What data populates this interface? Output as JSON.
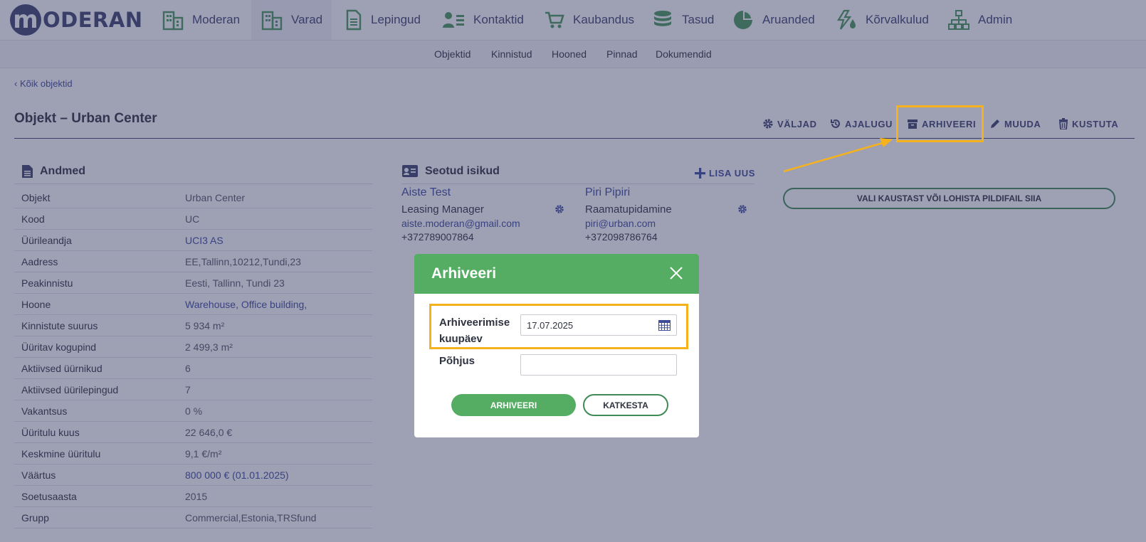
{
  "brand": {
    "logo_letter": "m",
    "logo_text": "ODERAN"
  },
  "nav": [
    {
      "label": "Moderan",
      "icon": "building-icon"
    },
    {
      "label": "Varad",
      "icon": "building-icon",
      "active": true
    },
    {
      "label": "Lepingud",
      "icon": "document-icon"
    },
    {
      "label": "Kontaktid",
      "icon": "contacts-icon"
    },
    {
      "label": "Kaubandus",
      "icon": "cart-icon"
    },
    {
      "label": "Tasud",
      "icon": "coins-icon"
    },
    {
      "label": "Aruanded",
      "icon": "pie-chart-icon"
    },
    {
      "label": "Kõrvalkulud",
      "icon": "utilities-icon"
    },
    {
      "label": "Admin",
      "icon": "sitemap-icon"
    }
  ],
  "subnav": [
    "Objektid",
    "Kinnistud",
    "Hooned",
    "Pinnad",
    "Dokumendid"
  ],
  "back_link": "‹ Kõik objektid",
  "page_title": "Objekt – Urban Center",
  "actions": {
    "fields": "VÄLJAD",
    "history": "AJALUGU",
    "archive": "ARHIVEERI",
    "edit": "MUUDA",
    "delete": "KUSTUTA"
  },
  "details": {
    "title": "Andmed",
    "rows": [
      {
        "label": "Objekt",
        "value": "Urban Center"
      },
      {
        "label": "Kood",
        "value": "UC"
      },
      {
        "label": "Üürileandja",
        "value": "UCI3 AS",
        "link": true
      },
      {
        "label": "Aadress",
        "value": "EE,Tallinn,10212,Tundi,23"
      },
      {
        "label": "Peakinnistu",
        "value": "Eesti, Tallinn, Tundi 23"
      },
      {
        "label": "Hoone",
        "value": "Warehouse, Office building,",
        "link": true
      },
      {
        "label": "Kinnistute suurus",
        "value": "5 934 m²"
      },
      {
        "label": "Üüritav kogupind",
        "value": "2 499,3 m²"
      },
      {
        "label": "Aktiivsed üürnikud",
        "value": "6"
      },
      {
        "label": "Aktiivsed üürilepingud",
        "value": "7"
      },
      {
        "label": "Vakantsus",
        "value": "0 %"
      },
      {
        "label": "Üüritulu kuus",
        "value": "22 646,0 €"
      },
      {
        "label": "Keskmine üüritulu",
        "value": "9,1 €/m²"
      },
      {
        "label": "Väärtus",
        "value": "800 000 € (01.01.2025)",
        "link": true
      },
      {
        "label": "Soetusaasta",
        "value": "2015"
      },
      {
        "label": "Grupp",
        "value": "Commercial,Estonia,TRSfund"
      }
    ]
  },
  "contacts": {
    "title": "Seotud isikud",
    "add_label": "LISA UUS",
    "people": [
      {
        "name": "Aiste Test",
        "role": "Leasing Manager",
        "email": "aiste.moderan@gmail.com",
        "phone": "+372789007864"
      },
      {
        "name": "Piri Pipiri",
        "role": "Raamatupidamine",
        "email": "piri@urban.com",
        "phone": "+372098786764"
      }
    ]
  },
  "upload_label": "VALI KAUSTAST VÕI LOHISTA PILDIFAIL SIIA",
  "modal": {
    "title": "Arhiveeri",
    "date_label": "Arhiveerimise kuupäev",
    "date_value": "17.07.2025",
    "reason_label": "Põhjus",
    "reason_value": "",
    "confirm_label": "ARHIVEERI",
    "cancel_label": "KATKESTA"
  },
  "colors": {
    "brand": "#3e4470",
    "link": "#3e4c9c",
    "modal_header": "#55ad63",
    "highlight": "#f5b21c"
  }
}
